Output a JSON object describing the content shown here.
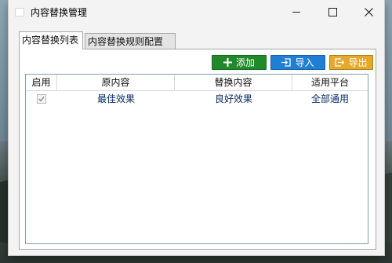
{
  "window": {
    "title": "内容替换管理"
  },
  "tabs": [
    {
      "label": "内容替换列表",
      "active": true
    },
    {
      "label": "内容替换规则配置",
      "active": false
    }
  ],
  "toolbar": {
    "add_label": "添加",
    "import_label": "导入",
    "export_label": "导出",
    "colors": {
      "add": "#1f8a2a",
      "import": "#1e7fd3",
      "export": "#e4a92b"
    }
  },
  "table": {
    "headers": [
      "启用",
      "原内容",
      "替换内容",
      "适用平台"
    ],
    "rows": [
      {
        "enabled": true,
        "original": "最佳效果",
        "replacement": "良好效果",
        "platform": "全部通用"
      }
    ]
  }
}
